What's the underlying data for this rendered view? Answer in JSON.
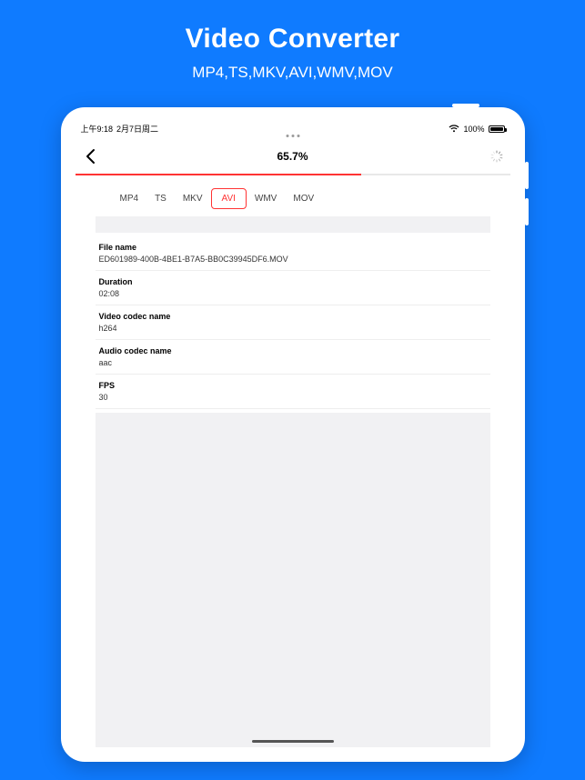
{
  "promo": {
    "title": "Video Converter",
    "subtitle": "MP4,TS,MKV,AVI,WMV,MOV"
  },
  "status": {
    "time": "上午9:18",
    "date": "2月7日周二",
    "battery_pct": "100%"
  },
  "nav": {
    "title": "65.7%",
    "progress_pct": 65.7
  },
  "tabs": [
    "MP4",
    "TS",
    "MKV",
    "AVI",
    "WMV",
    "MOV"
  ],
  "active_tab_index": 3,
  "info": [
    {
      "label": "File name",
      "value": "ED601989-400B-4BE1-B7A5-BB0C39945DF6.MOV"
    },
    {
      "label": "Duration",
      "value": "02:08"
    },
    {
      "label": "Video codec name",
      "value": "h264"
    },
    {
      "label": "Audio codec name",
      "value": "aac"
    },
    {
      "label": "FPS",
      "value": "30"
    }
  ]
}
